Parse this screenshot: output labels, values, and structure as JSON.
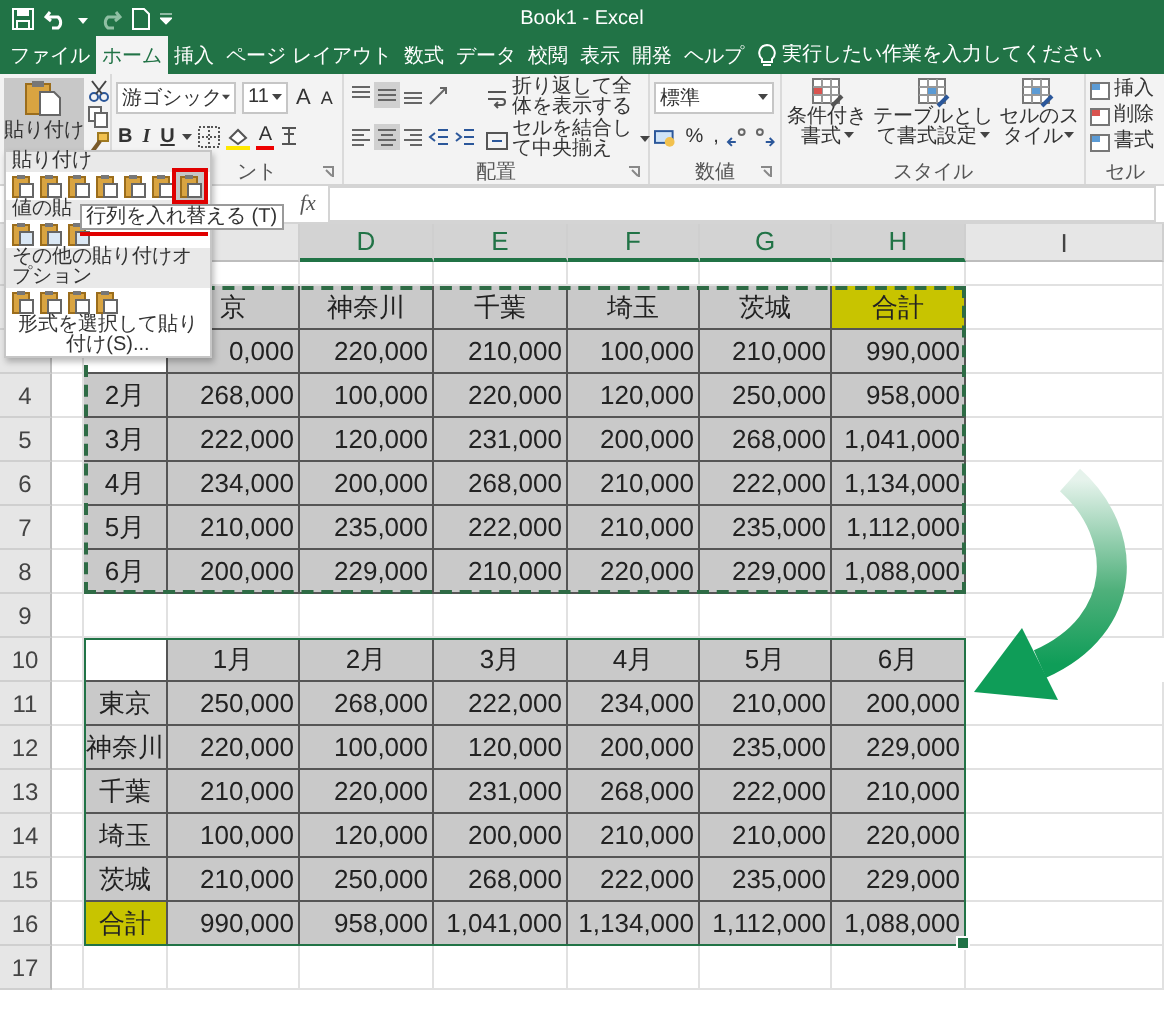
{
  "title_bar": {
    "title": "Book1 - Excel"
  },
  "tabs": [
    {
      "label": "ファイル",
      "selected": false
    },
    {
      "label": "ホーム",
      "selected": true
    },
    {
      "label": "挿入",
      "selected": false
    },
    {
      "label": "ページ レイアウト",
      "selected": false
    },
    {
      "label": "数式",
      "selected": false
    },
    {
      "label": "データ",
      "selected": false
    },
    {
      "label": "校閲",
      "selected": false
    },
    {
      "label": "表示",
      "selected": false
    },
    {
      "label": "開発",
      "selected": false
    },
    {
      "label": "ヘルプ",
      "selected": false
    }
  ],
  "tell_me": {
    "placeholder": "実行したい作業を入力してください"
  },
  "ribbon": {
    "clipboard": {
      "paste": "貼り付け"
    },
    "font": {
      "font_name": "游ゴシック",
      "font_size": "11",
      "grow": "A",
      "shrink": "A",
      "styles": [
        "B",
        "I",
        "U"
      ],
      "font_color": "A",
      "group_label": "ント"
    },
    "alignment": {
      "wrap_text": "折り返して全体を表示する",
      "merge": "セルを結合して中央揃え",
      "group_label": "配置"
    },
    "number": {
      "format": "標準",
      "percent": "%",
      "comma": ",",
      "group_label": "数値"
    },
    "styles": {
      "buttons": [
        "条件付き書式",
        "テーブルとして書式設定",
        "セルのスタイル"
      ],
      "group_label": "スタイル"
    },
    "cells": {
      "buttons": [
        "挿入",
        "削除",
        "書式"
      ],
      "group_label": "セル"
    }
  },
  "paste_menu": {
    "sections": [
      {
        "heading": "貼り付け",
        "options": [
          {
            "selected": false
          },
          {
            "selected": false
          },
          {
            "selected": false
          },
          {
            "selected": false
          },
          {
            "selected": false
          },
          {
            "selected": false
          },
          {
            "selected": true
          }
        ]
      },
      {
        "heading": "値の貼",
        "options": [
          {
            "selected": false
          },
          {
            "selected": false
          },
          {
            "selected": false
          }
        ]
      },
      {
        "heading": "その他の貼り付けオプション",
        "options": [
          {
            "selected": false
          },
          {
            "selected": false
          },
          {
            "selected": false
          },
          {
            "selected": false
          }
        ]
      }
    ],
    "footer": "形式を選択して貼り付け(S)...",
    "tooltip": "行列を入れ替える (T)"
  },
  "formula_bar": {
    "fx": "fx"
  },
  "sheet": {
    "column_headers": [
      {
        "label": "D",
        "selected": true
      },
      {
        "label": "E",
        "selected": true
      },
      {
        "label": "F",
        "selected": true
      },
      {
        "label": "G",
        "selected": true
      },
      {
        "label": "H",
        "selected": true
      },
      {
        "label": "I",
        "selected": false
      }
    ],
    "row_numbers": [
      "4",
      "5",
      "6",
      "7",
      "8",
      "9",
      "10",
      "11",
      "12",
      "13",
      "14",
      "15",
      "16",
      "17"
    ],
    "source_table": {
      "copied": true,
      "rows": [
        [
          "",
          "京",
          "神奈川",
          "千葉",
          "埼玉",
          "茨城",
          {
            "text": "合計",
            "highlighted": true
          }
        ],
        [
          "",
          "0,000",
          "220,000",
          "210,000",
          "100,000",
          "210,000",
          "990,000"
        ],
        [
          "2月",
          "268,000",
          "100,000",
          "220,000",
          "120,000",
          "250,000",
          "958,000"
        ],
        [
          "3月",
          "222,000",
          "120,000",
          "231,000",
          "200,000",
          "268,000",
          "1,041,000"
        ],
        [
          "4月",
          "234,000",
          "200,000",
          "268,000",
          "210,000",
          "222,000",
          "1,134,000"
        ],
        [
          "5月",
          "210,000",
          "235,000",
          "222,000",
          "210,000",
          "235,000",
          "1,112,000"
        ],
        [
          "6月",
          "200,000",
          "229,000",
          "210,000",
          "220,000",
          "229,000",
          "1,088,000"
        ]
      ]
    },
    "result_table": {
      "selected": true,
      "rows": [
        [
          "",
          "1月",
          "2月",
          "3月",
          "4月",
          "5月",
          "6月"
        ],
        [
          "東京",
          "250,000",
          "268,000",
          "222,000",
          "234,000",
          "210,000",
          "200,000"
        ],
        [
          "神奈川",
          "220,000",
          "100,000",
          "120,000",
          "200,000",
          "235,000",
          "229,000"
        ],
        [
          "千葉",
          "210,000",
          "220,000",
          "231,000",
          "268,000",
          "222,000",
          "210,000"
        ],
        [
          "埼玉",
          "100,000",
          "120,000",
          "200,000",
          "210,000",
          "210,000",
          "220,000"
        ],
        [
          "茨城",
          "210,000",
          "250,000",
          "268,000",
          "222,000",
          "235,000",
          "229,000"
        ],
        [
          {
            "text": "合計",
            "highlighted": true
          },
          "990,000",
          "958,000",
          "1,041,000",
          "1,134,000",
          "1,112,000",
          "1,088,000"
        ]
      ]
    }
  }
}
